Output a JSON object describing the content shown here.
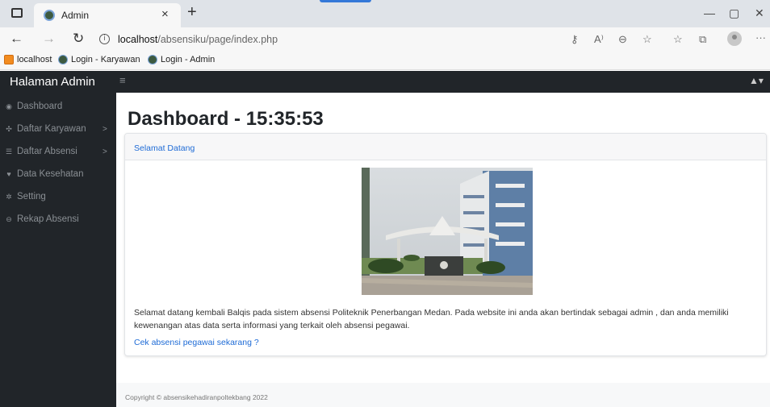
{
  "browser": {
    "tab_title": "Admin",
    "tab_close": "×",
    "new_tab": "+",
    "url_host": "localhost",
    "url_path": "/absensiku/page/index.php",
    "favorites": [
      {
        "label": "localhost"
      },
      {
        "label": "Login - Karyawan"
      },
      {
        "label": "Login - Admin"
      }
    ]
  },
  "app": {
    "brand": "Halaman Admin",
    "toggle_icon": "≡",
    "user_menu": "▲▾",
    "sidebar": {
      "items": [
        {
          "label": "Dashboard",
          "icon": "dashboard-icon",
          "glyph": "◉",
          "chevron": ""
        },
        {
          "label": "Daftar Karyawan",
          "icon": "users-icon",
          "glyph": "✣",
          "chevron": ">"
        },
        {
          "label": "Daftar Absensi",
          "icon": "list-icon",
          "glyph": "☰",
          "chevron": ">"
        },
        {
          "label": "Data Kesehatan",
          "icon": "heart-icon",
          "glyph": "♥",
          "chevron": ""
        },
        {
          "label": "Setting",
          "icon": "cogs-icon",
          "glyph": "✲",
          "chevron": ""
        },
        {
          "label": "Rekap Absensi",
          "icon": "print-icon",
          "glyph": "⊖",
          "chevron": ""
        }
      ]
    },
    "page_title_prefix": "Dashboard - ",
    "clock": "15:35:53",
    "card": {
      "header": "Selamat Datang",
      "body_text": "Selamat datang kembali Balqis pada sistem absensi Politeknik Penerbangan Medan. Pada website ini anda akan bertindak sebagai admin , dan anda memiliki kewenangan atas data serta informasi yang terkait oleh absensi pegawai.",
      "link": "Cek absensi pegawai sekarang ?"
    },
    "footer": "Copyright © absensikehadiranpoltekbang 2022"
  }
}
